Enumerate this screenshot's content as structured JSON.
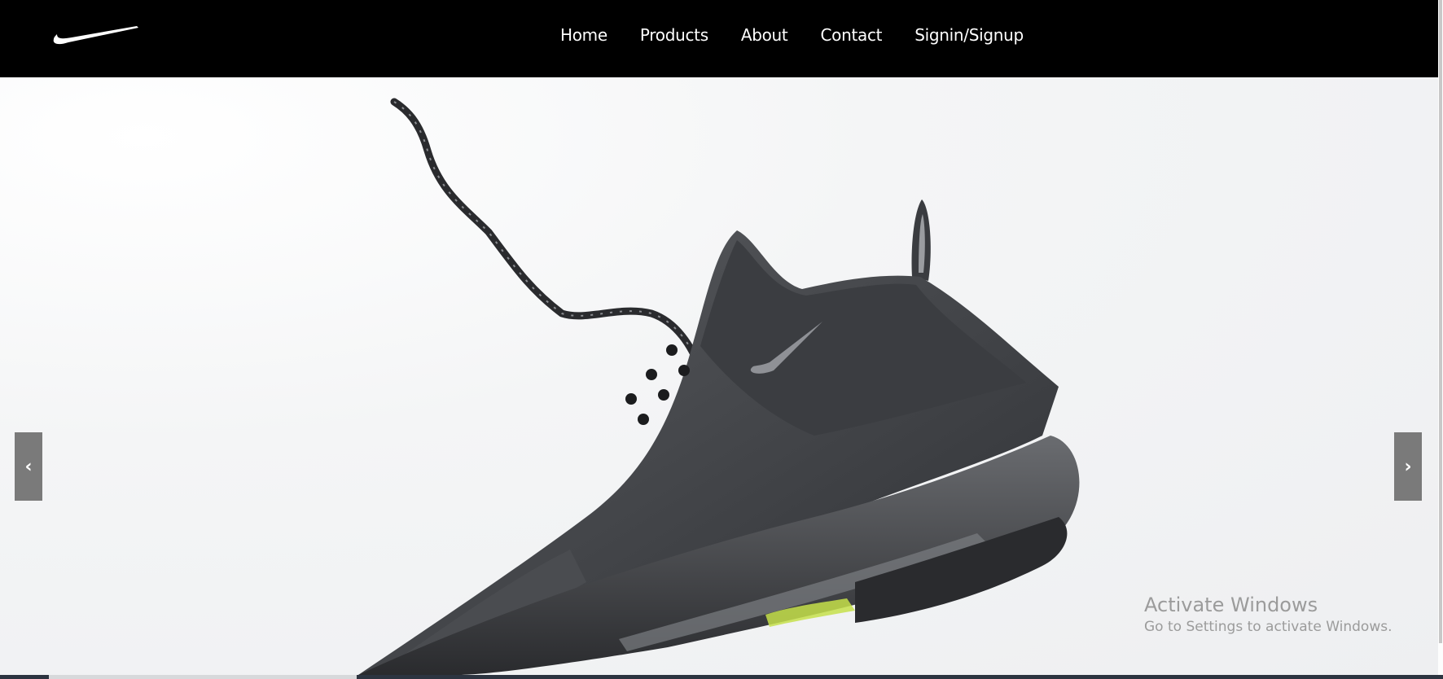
{
  "nav": {
    "logo": "swoosh-logo",
    "links": [
      "Home",
      "Products",
      "About",
      "Contact",
      "Signin/Signup"
    ]
  },
  "carousel": {
    "prev_icon": "chevron-left-icon",
    "next_icon": "chevron-right-icon",
    "prev_glyph": "‹",
    "next_glyph": "›"
  },
  "watermark": {
    "title": "Activate Windows",
    "subtitle": "Go to Settings to activate Windows."
  },
  "colors": {
    "navbar": "#000000",
    "hero_bg": "#f1f2f3",
    "button": "#7a7a7a",
    "accent_sole": "#c6e04a"
  }
}
